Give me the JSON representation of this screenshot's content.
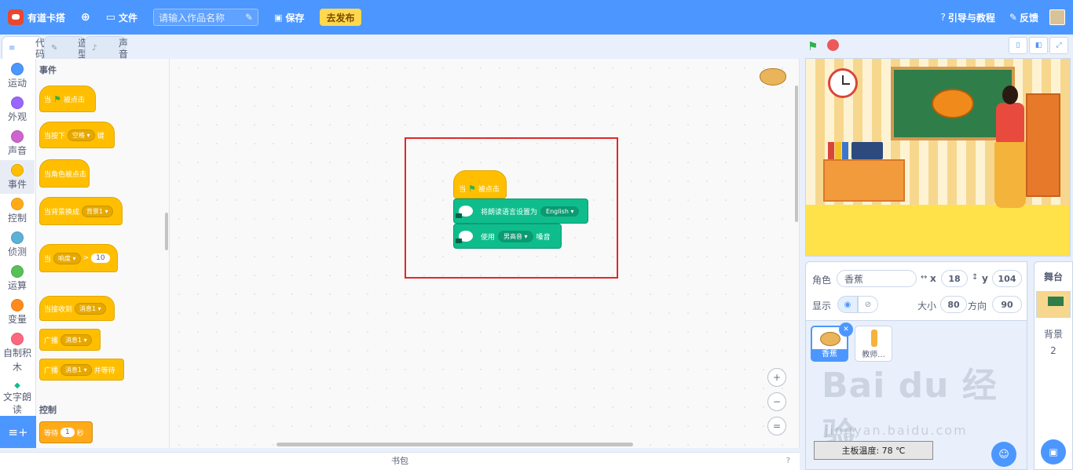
{
  "topbar": {
    "logo": "有道卡搭",
    "file": "文件",
    "project_name_placeholder": "请输入作品名称",
    "save": "保存",
    "publish": "去发布",
    "guide": "引导与教程",
    "feedback": "反馈"
  },
  "tabs": [
    {
      "label": "代码"
    },
    {
      "label": "造型"
    },
    {
      "label": "声音"
    }
  ],
  "categories": [
    {
      "label": "运动",
      "color": "#4c97ff"
    },
    {
      "label": "外观",
      "color": "#9966ff"
    },
    {
      "label": "声音",
      "color": "#cf63cf"
    },
    {
      "label": "事件",
      "color": "#ffbf00"
    },
    {
      "label": "控制",
      "color": "#ffab19"
    },
    {
      "label": "侦测",
      "color": "#5cb1d6"
    },
    {
      "label": "运算",
      "color": "#59c059"
    },
    {
      "label": "变量",
      "color": "#ff8c1a"
    },
    {
      "label": "自制积木",
      "color": "#ff6680"
    },
    {
      "label": "文字朗读",
      "color": "#0fbd8c"
    }
  ],
  "palette": {
    "section_events": "事件",
    "section_control": "控制",
    "blocks": {
      "when_flag_a": "当",
      "when_flag_b": "被点击",
      "key_pressed_a": "当按下",
      "key_pressed_key": "空格",
      "key_pressed_b": "键",
      "sprite_clicked": "当角色被点击",
      "backdrop_a": "当背景换成",
      "backdrop_value": "背景1",
      "loudness_a": "当",
      "loudness_value": "响度",
      "loudness_op": ">",
      "loudness_num": "10",
      "receive_a": "当接收到",
      "receive_value": "消息1",
      "broadcast_a": "广播",
      "broadcast_value": "消息1",
      "broadcast_wait_a": "广播",
      "broadcast_wait_value": "消息1",
      "broadcast_wait_b": "并等待",
      "wait_a": "等待",
      "wait_num": "1",
      "wait_b": "秒"
    }
  },
  "script": {
    "hat_a": "当",
    "hat_b": "被点击",
    "lang_label": "将朗读语言设置为",
    "lang_value": "English",
    "voice_a": "使用",
    "voice_value": "男高音",
    "voice_b": "嗓音"
  },
  "backpack": {
    "label": "书包"
  },
  "sprite_info": {
    "sprite_label": "角色",
    "sprite_name": "香蕉",
    "x_label": "x",
    "x_value": "18",
    "y_label": "y",
    "y_value": "104",
    "show_label": "显示",
    "size_label": "大小",
    "size_value": "80",
    "direction_label": "方向",
    "direction_value": "90"
  },
  "sprites": [
    {
      "name": "香蕉"
    },
    {
      "name": "教师..."
    }
  ],
  "temperature": "主板温度: 78 ℃",
  "watermark": {
    "main": "Bai du 经验",
    "sub": "jingyan.baidu.com"
  },
  "stage_panel": {
    "title": "舞台",
    "backdrop_label": "背景",
    "backdrop_count": "2"
  }
}
